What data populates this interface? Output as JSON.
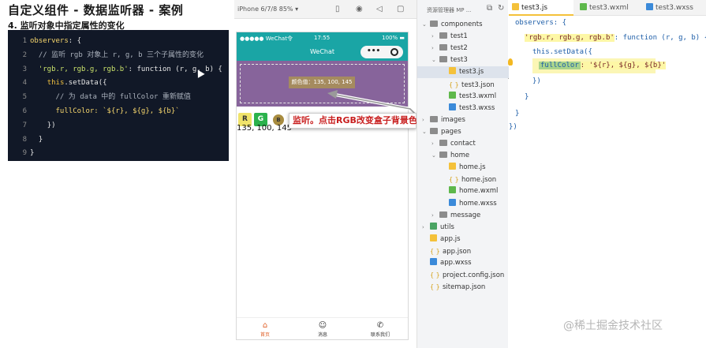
{
  "title": "自定义组件 - 数据监听器 - 案例",
  "subtitle": "4. 监听对象中指定属性的变化",
  "code": {
    "line_numbers": [
      "1",
      "2",
      "3",
      "4",
      "5",
      "6",
      "7",
      "8",
      "9"
    ],
    "l1_key": "observers",
    "l1_rest": ": {",
    "l2_comment": "// 监听 rgb 对象上 r, g, b 三个子属性的变化",
    "l3_str": "'rgb.r, rgb.g, rgb.b'",
    "l3_rest": ": function (r, g, b) {",
    "l4_kw": "this",
    "l4_rest": ".setData({",
    "l5_comment": "// 为 data 中的 fullColor 重新赋值",
    "l6_key": "fullColor",
    "l6_rest": ": `${r}, ${g}, ${b}`",
    "l7": "})",
    "l8": "}",
    "l9": "}"
  },
  "simulator": {
    "device": "iPhone 6/7/8 85% ▾",
    "status_left": "●●●●● WeChat令",
    "status_time": "17:55",
    "status_right": "100% ▬",
    "nav_title": "WeChat",
    "capsule_dots": "•••",
    "box_color": "#87649b",
    "color_label": "颜色值：135, 100, 145",
    "buttons": {
      "r": "R",
      "g": "G",
      "b": "B"
    },
    "rgb_text": "135, 100, 145",
    "tabs": [
      {
        "label": "首页",
        "icon": "⌂"
      },
      {
        "label": "消息",
        "icon": "☺"
      },
      {
        "label": "联系我们",
        "icon": "✆"
      }
    ]
  },
  "callout_text": "监听。点击RGB改变盒子背景色",
  "tree": {
    "header": "资源管理器 MP ...",
    "items": [
      {
        "label": "components",
        "depth": 0,
        "type": "folder",
        "open": true
      },
      {
        "label": "test1",
        "depth": 1,
        "type": "folder",
        "open": false
      },
      {
        "label": "test2",
        "depth": 1,
        "type": "folder",
        "open": false
      },
      {
        "label": "test3",
        "depth": 1,
        "type": "folder",
        "open": true
      },
      {
        "label": "test3.js",
        "depth": 2,
        "type": "js",
        "selected": true
      },
      {
        "label": "test3.json",
        "depth": 2,
        "type": "json"
      },
      {
        "label": "test3.wxml",
        "depth": 2,
        "type": "wxml"
      },
      {
        "label": "test3.wxss",
        "depth": 2,
        "type": "wxss"
      },
      {
        "label": "images",
        "depth": 0,
        "type": "folder",
        "open": false
      },
      {
        "label": "pages",
        "depth": 0,
        "type": "folder",
        "open": true
      },
      {
        "label": "contact",
        "depth": 1,
        "type": "folder",
        "open": false
      },
      {
        "label": "home",
        "depth": 1,
        "type": "folder",
        "open": true
      },
      {
        "label": "home.js",
        "depth": 2,
        "type": "js"
      },
      {
        "label": "home.json",
        "depth": 2,
        "type": "json"
      },
      {
        "label": "home.wxml",
        "depth": 2,
        "type": "wxml"
      },
      {
        "label": "home.wxss",
        "depth": 2,
        "type": "wxss"
      },
      {
        "label": "message",
        "depth": 1,
        "type": "folder",
        "open": false
      },
      {
        "label": "utils",
        "depth": 0,
        "type": "green",
        "open": false
      },
      {
        "label": "app.js",
        "depth": 0,
        "type": "js"
      },
      {
        "label": "app.json",
        "depth": 0,
        "type": "json"
      },
      {
        "label": "app.wxss",
        "depth": 0,
        "type": "wxss"
      },
      {
        "label": "project.config.json",
        "depth": 0,
        "type": "json"
      },
      {
        "label": "sitemap.json",
        "depth": 0,
        "type": "json"
      }
    ]
  },
  "editor": {
    "tabs": [
      "test3.js",
      "test3.wxml",
      "test3.wxss"
    ],
    "l1": "observers: {",
    "l2_str": "'rgb.r, rgb.g, rgb.b'",
    "l2_rest": ": function (r, g, b) {",
    "l3": "this.setData({",
    "l4_key": "fullColor",
    "l4_rest": ": '${r}, ${g}, ${b}'",
    "l5": "})",
    "l6": "}",
    "l7": "}",
    "l8": "})"
  },
  "watermark": "@稀土掘金技术社区"
}
